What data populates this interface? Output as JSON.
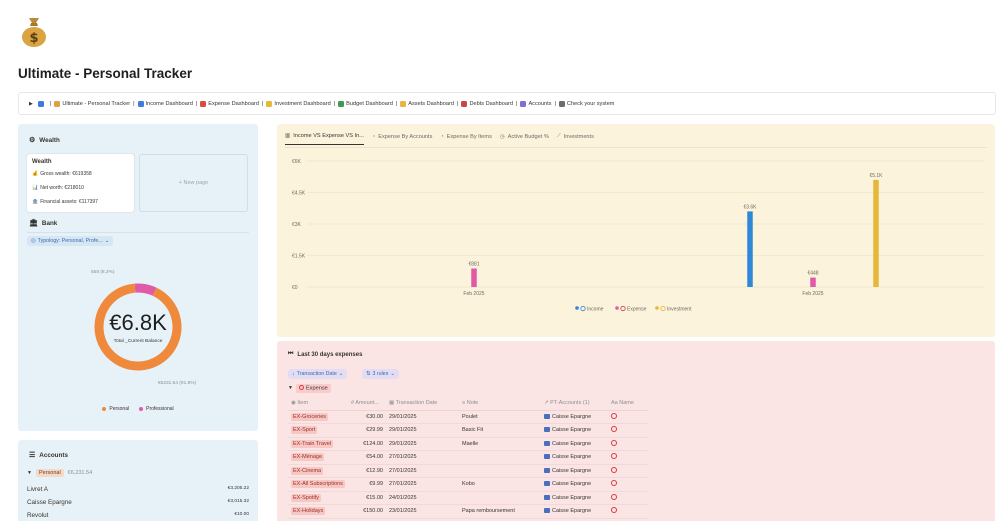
{
  "page": {
    "icon": "money-bag-icon",
    "title": "Ultimate - Personal Tracker"
  },
  "breadcrumb": [
    {
      "label": "Ultimate - Personal Tracker",
      "icon": "money-bag-icon",
      "color": "#d9a441"
    },
    {
      "label": "Income Dashboard",
      "icon": "globe-icon",
      "color": "#3b7dd8"
    },
    {
      "label": "Expense Dashboard",
      "icon": "magnifier-icon",
      "color": "#d94c3b"
    },
    {
      "label": "Investment Dashboard",
      "icon": "coin-icon",
      "color": "#e6b93a"
    },
    {
      "label": "Budget Dashboard",
      "icon": "ledger-icon",
      "color": "#3d9a4f"
    },
    {
      "label": "Assets Dashboard",
      "icon": "sparkle-icon",
      "color": "#e7b640"
    },
    {
      "label": "Debts Dashboard",
      "icon": "scissors-icon",
      "color": "#c94747"
    },
    {
      "label": "Accounts",
      "icon": "cards-icon",
      "color": "#7a6fd3"
    },
    {
      "label": "Check your system",
      "icon": "calendar-icon",
      "color": "#6c6c6c"
    }
  ],
  "wealth": {
    "section_title": "Wealth",
    "card_title": "Wealth",
    "gross_wealth": "Gross wealth: €619358",
    "net_worth": "Net worth: €218010",
    "financial_assets": "Financial assets: €117397",
    "new_page": "+ New page"
  },
  "bank": {
    "section_title": "Bank",
    "filter_label": "Typology: Personal, Profe...",
    "donut": {
      "center_value": "€6.8K",
      "center_label": "Total _Current Balance",
      "label_top": "558 (8.2%)",
      "label_bottom": "€6231.54 (91.8%)",
      "slices": [
        {
          "name": "Personal",
          "value": 6231.54,
          "color": "#ef8a3d"
        },
        {
          "name": "Professional",
          "value": 558,
          "color": "#e05aa8"
        }
      ]
    }
  },
  "accounts": {
    "section_title": "Accounts",
    "group_label": "Personal",
    "group_total": "€6,231.54",
    "rows": [
      {
        "name": "Livret A",
        "amount": "€3,205.22"
      },
      {
        "name": "Caisse Epargne",
        "amount": "€3,015.32"
      },
      {
        "name": "Revolut",
        "amount": "€10.00"
      }
    ]
  },
  "chart_tabs": [
    {
      "label": "Income VS Expense VS In...",
      "icon": "bar-chart-icon",
      "active": true
    },
    {
      "label": "Expense By Accounts",
      "icon": "pie-chart-icon",
      "active": false
    },
    {
      "label": "Expense By Items",
      "icon": "pie-chart-icon",
      "active": false
    },
    {
      "label": "Active Budget %",
      "icon": "clock-icon",
      "active": false
    },
    {
      "label": "Investments",
      "icon": "line-chart-icon",
      "active": false
    }
  ],
  "chart_data": {
    "type": "bar",
    "y_ticks": [
      "€6K",
      "€4.5K",
      "€3K",
      "€1.5K",
      "€0"
    ],
    "ylim": [
      0,
      6000
    ],
    "groups": [
      {
        "label": "Feb 2025",
        "bars": [
          {
            "series": "Expense",
            "value": 881,
            "label": "€881"
          }
        ]
      },
      {
        "label": "Feb 2025",
        "bars": [
          {
            "series": "Income",
            "value": 3600,
            "label": "€3.6K"
          },
          {
            "series": "Expense",
            "value": 448,
            "label": "€448"
          },
          {
            "series": "Investment",
            "value": 5100,
            "label": "€5.1K"
          }
        ]
      }
    ],
    "series": [
      {
        "name": "Income",
        "color": "#2e87d8"
      },
      {
        "name": "Expense",
        "color": "#e05aa8"
      },
      {
        "name": "Investment",
        "color": "#e5b83a"
      }
    ]
  },
  "expenses": {
    "title": "Last 30 days expenses",
    "filter_date": "Transaction Date",
    "filter_rules": "3 rules",
    "group_label": "Expense",
    "columns": [
      "Item",
      "Amount...",
      "Transaction Date",
      "Note",
      "PT-Accounts (1)",
      "Name"
    ],
    "rows": [
      {
        "item": "EX-Groceries",
        "amount": "€30.00",
        "date": "29/01/2025",
        "note": "Poulet",
        "account": "Caisse Epargne"
      },
      {
        "item": "EX-Sport",
        "amount": "€29.99",
        "date": "29/01/2025",
        "note": "Basic Fit",
        "account": "Caisse Epargne"
      },
      {
        "item": "EX-Train Travel",
        "amount": "€124.00",
        "date": "29/01/2025",
        "note": "Maelle",
        "account": "Caisse Epargne"
      },
      {
        "item": "EX-Ménage",
        "amount": "€54.00",
        "date": "27/01/2025",
        "note": "",
        "account": "Caisse Epargne"
      },
      {
        "item": "EX-Cinema",
        "amount": "€12.90",
        "date": "27/01/2025",
        "note": "",
        "account": "Caisse Epargne"
      },
      {
        "item": "EX-All Subscriptions",
        "amount": "€9.99",
        "date": "27/01/2025",
        "note": "Kobo",
        "account": "Caisse Epargne"
      },
      {
        "item": "EX-Spotify",
        "amount": "€15.00",
        "date": "24/01/2025",
        "note": "",
        "account": "Caisse Epargne"
      },
      {
        "item": "EX-Holidays",
        "amount": "€150.00",
        "date": "23/01/2025",
        "note": "Papa remboursement",
        "account": "Caisse Epargne"
      }
    ]
  }
}
